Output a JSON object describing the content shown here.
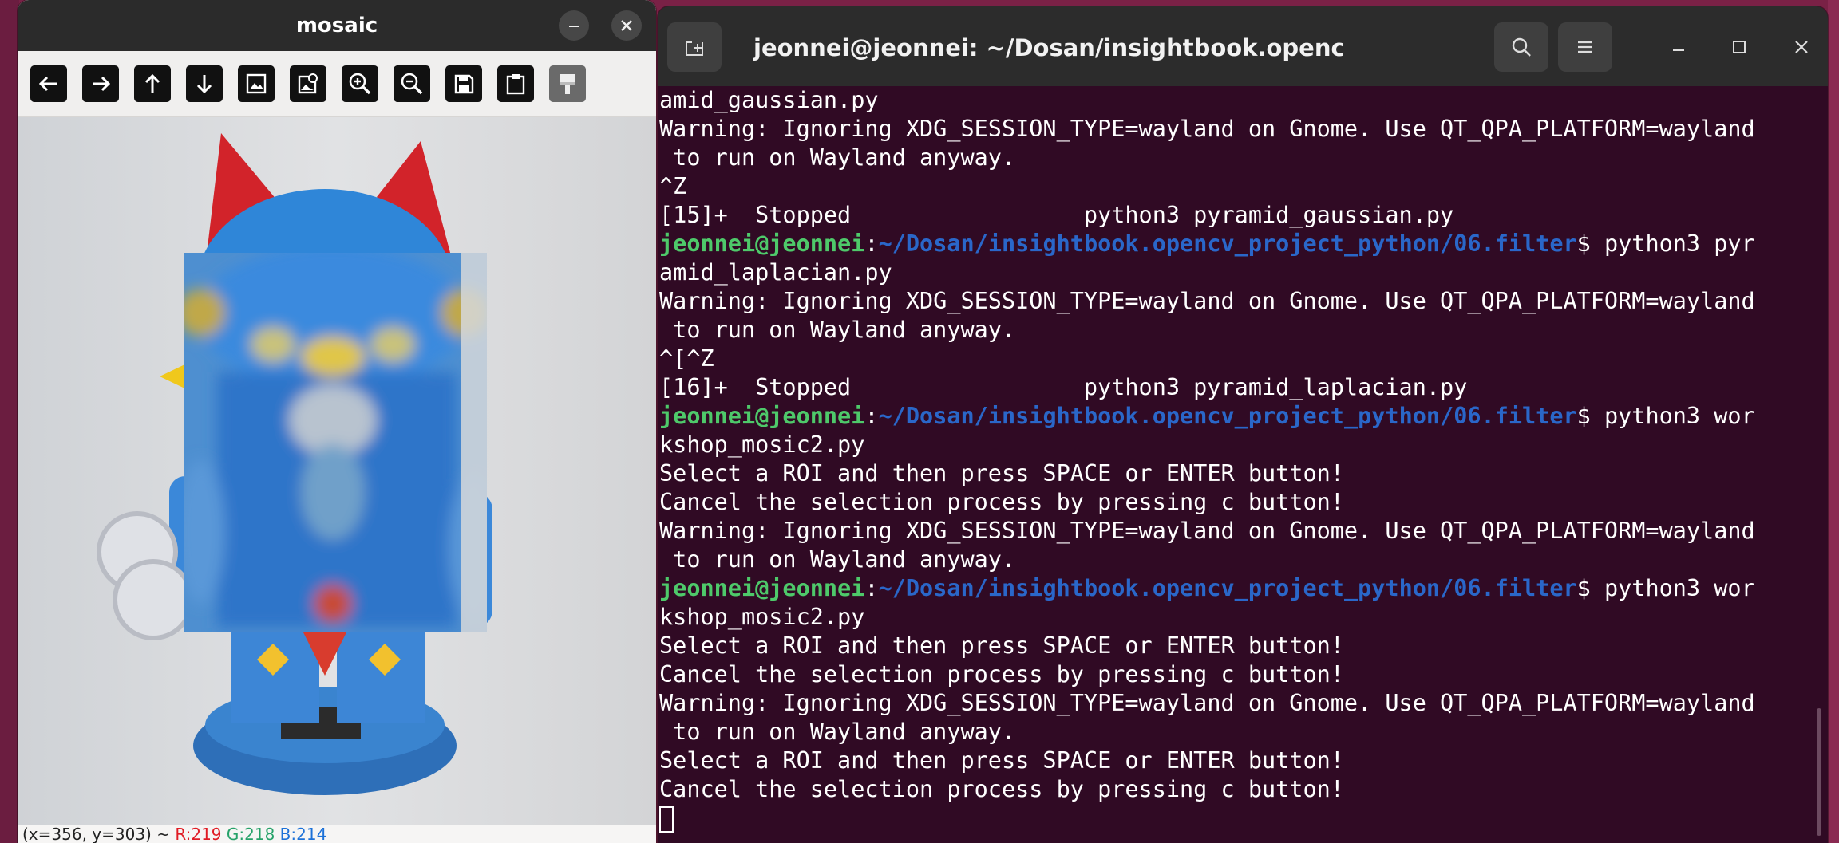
{
  "cv_window": {
    "title": "mosaic",
    "minimize_icon": "minimize-icon",
    "close_icon": "close-icon",
    "toolbar": [
      {
        "name": "pan-left-button",
        "icon": "arrow-left-icon"
      },
      {
        "name": "pan-right-button",
        "icon": "arrow-right-icon"
      },
      {
        "name": "pan-up-button",
        "icon": "arrow-up-icon"
      },
      {
        "name": "pan-down-button",
        "icon": "arrow-down-icon"
      },
      {
        "name": "zoom-original-button",
        "icon": "image-icon"
      },
      {
        "name": "zoom-fit-button",
        "icon": "image-zoom-icon"
      },
      {
        "name": "zoom-in-button",
        "icon": "zoom-in-icon"
      },
      {
        "name": "zoom-out-button",
        "icon": "zoom-out-icon"
      },
      {
        "name": "save-image-button",
        "icon": "save-icon"
      },
      {
        "name": "properties-button",
        "icon": "clipboard-icon"
      },
      {
        "name": "brush-button",
        "icon": "brush-icon",
        "disabled": true
      }
    ],
    "status": {
      "coords": "(x=356, y=303) ~ ",
      "r": "R:219",
      "g": "G:218",
      "b": "B:214"
    }
  },
  "terminal": {
    "title": "jeonnei@jeonnei: ~/Dosan/insightbook.opencv_project_pyth...",
    "new_tab_icon": "new-tab-icon",
    "search_icon": "search-icon",
    "menu_icon": "hamburger-menu-icon",
    "minimize_icon": "minimize-icon",
    "maximize_icon": "maximize-icon",
    "close_icon": "close-icon",
    "prompt_user": "jeonnei@jeonnei",
    "prompt_path": "~/Dosan/insightbook.opencv_project_python/06.filter",
    "lines": [
      {
        "t": "amid_gaussian.py"
      },
      {
        "t": "Warning: Ignoring XDG_SESSION_TYPE=wayland on Gnome. Use QT_QPA_PLATFORM=wayland"
      },
      {
        "t": " to run on Wayland anyway."
      },
      {
        "t": "^Z"
      },
      {
        "t": "[15]+  Stopped                 python3 pyramid_gaussian.py"
      },
      {
        "prompt": true,
        "cmd": " python3 pyr"
      },
      {
        "t": "amid_laplacian.py"
      },
      {
        "t": "Warning: Ignoring XDG_SESSION_TYPE=wayland on Gnome. Use QT_QPA_PLATFORM=wayland"
      },
      {
        "t": " to run on Wayland anyway."
      },
      {
        "t": "^[^Z"
      },
      {
        "t": "[16]+  Stopped                 python3 pyramid_laplacian.py"
      },
      {
        "prompt": true,
        "cmd": " python3 wor"
      },
      {
        "t": "kshop_mosic2.py"
      },
      {
        "t": "Select a ROI and then press SPACE or ENTER button!"
      },
      {
        "t": "Cancel the selection process by pressing c button!"
      },
      {
        "t": "Warning: Ignoring XDG_SESSION_TYPE=wayland on Gnome. Use QT_QPA_PLATFORM=wayland"
      },
      {
        "t": " to run on Wayland anyway."
      },
      {
        "prompt": true,
        "cmd": " python3 wor"
      },
      {
        "t": "kshop_mosic2.py"
      },
      {
        "t": "Select a ROI and then press SPACE or ENTER button!"
      },
      {
        "t": "Cancel the selection process by pressing c button!"
      },
      {
        "t": "Warning: Ignoring XDG_SESSION_TYPE=wayland on Gnome. Use QT_QPA_PLATFORM=wayland"
      },
      {
        "t": " to run on Wayland anyway."
      },
      {
        "t": "Select a ROI and then press SPACE or ENTER button!"
      },
      {
        "t": "Cancel the selection process by pressing c button!"
      },
      {
        "cursor": true
      }
    ]
  }
}
